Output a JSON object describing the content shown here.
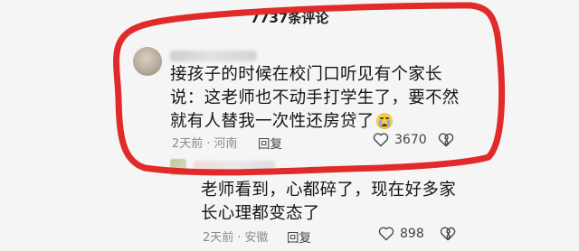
{
  "header": {
    "title": "7737条评论"
  },
  "colors": {
    "annotation_red": "#e12a2a",
    "background": "#f5f5f5",
    "meta_gray": "#8a8a8a"
  },
  "comments": [
    {
      "text": "接孩子的时候在校门口听见有个家长说：这老师也不动手打学生了，要不然就有人替我一次性还房贷了",
      "emoji": "crying-face",
      "time": "2天前",
      "location": "河南",
      "reply_label": "回复",
      "likes": "3670",
      "icons": [
        "heart-icon",
        "broken-heart-icon"
      ]
    },
    {
      "text": "老师看到，心都碎了，现在好多家长心理都变态了",
      "time": "2天前",
      "location": "安徽",
      "reply_label": "回复",
      "likes": "898",
      "icons": [
        "heart-icon",
        "broken-heart-icon"
      ]
    }
  ]
}
